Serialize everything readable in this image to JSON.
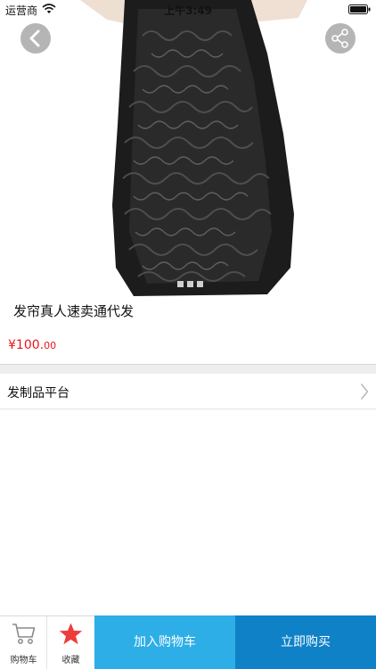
{
  "status_bar": {
    "carrier": "运营商",
    "time": "上午3:49"
  },
  "product": {
    "title": "发帘真人速卖通代发",
    "price_main": "¥100.",
    "price_cents": "00",
    "image_page_count": 3,
    "image_current_page": 1
  },
  "shop": {
    "name": "发制品平台"
  },
  "bottom_bar": {
    "cart_label": "购物车",
    "favorite_label": "收藏",
    "add_to_cart_label": "加入购物车",
    "buy_now_label": "立即购买"
  },
  "icons": {
    "back": "chevron-left-icon",
    "share": "share-icon",
    "shop_arrow": "chevron-right-icon",
    "cart": "cart-icon",
    "favorite": "star-icon"
  },
  "colors": {
    "price": "#e8161d",
    "add_to_cart": "#2daee6",
    "buy_now": "#0e81c7",
    "favorite_star": "#ee3c3c"
  }
}
